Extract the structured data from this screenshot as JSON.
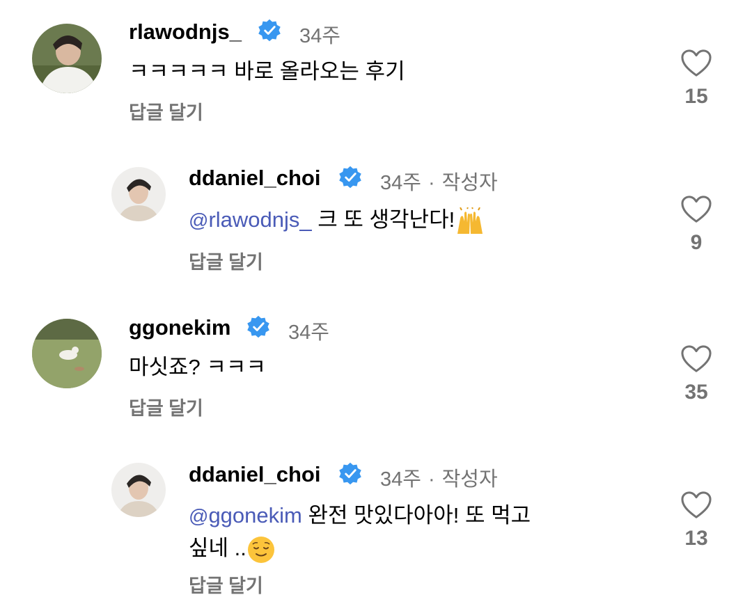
{
  "comments": [
    {
      "username": "rlawodnjs_",
      "time": "34주",
      "author_badge": "",
      "mention": "",
      "text": "ㅋㅋㅋㅋㅋ 바로 올라오는 후기",
      "reply_label": "답글 달기",
      "likes": "15",
      "avatar_icon": "profile-photo"
    },
    {
      "username": "ddaniel_choi",
      "time": "34주",
      "author_badge": "작성자",
      "mention": "rlawodnjs_",
      "text": " 크 또 생각난다!",
      "emoji": "raising-hands-emoji",
      "reply_label": "답글 달기",
      "likes": "9",
      "avatar_icon": "profile-photo"
    },
    {
      "username": "ggonekim",
      "time": "34주",
      "author_badge": "",
      "mention": "",
      "text": "마싯죠? ㅋㅋㅋ",
      "reply_label": "답글 달기",
      "likes": "35",
      "avatar_icon": "profile-photo"
    },
    {
      "username": "ddaniel_choi",
      "time": "34주",
      "author_badge": "작성자",
      "mention": "ggonekim",
      "text_line1": " 완전 맛있다아아! 또 먹고",
      "text_line2": "싶네 ..",
      "emoji": "relieved-face-emoji",
      "reply_label": "답글 달기",
      "likes": "13",
      "avatar_icon": "profile-photo"
    }
  ],
  "colors": {
    "mention": "#4a5bb7",
    "secondary_text": "#737373",
    "verified": "#3897f0"
  }
}
